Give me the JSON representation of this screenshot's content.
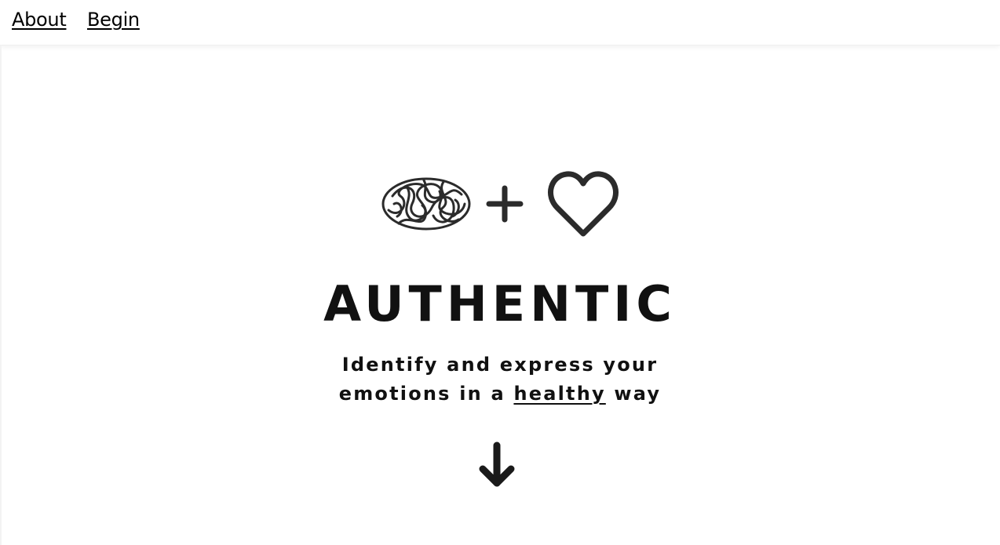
{
  "nav": {
    "about_label": "About",
    "begin_label": "Begin"
  },
  "hero": {
    "icons": [
      "brain-icon",
      "plus-icon",
      "heart-icon"
    ],
    "title": "AUTHENTIC",
    "subtitle_line1": "Identify and express your",
    "subtitle_line2_before": "emotions in a ",
    "subtitle_highlight": "healthy",
    "subtitle_line2_after": " way",
    "scroll_icon": "arrow-down-icon"
  },
  "colors": {
    "text": "#111111",
    "background": "#ffffff",
    "icon": "#2b2b2b"
  }
}
